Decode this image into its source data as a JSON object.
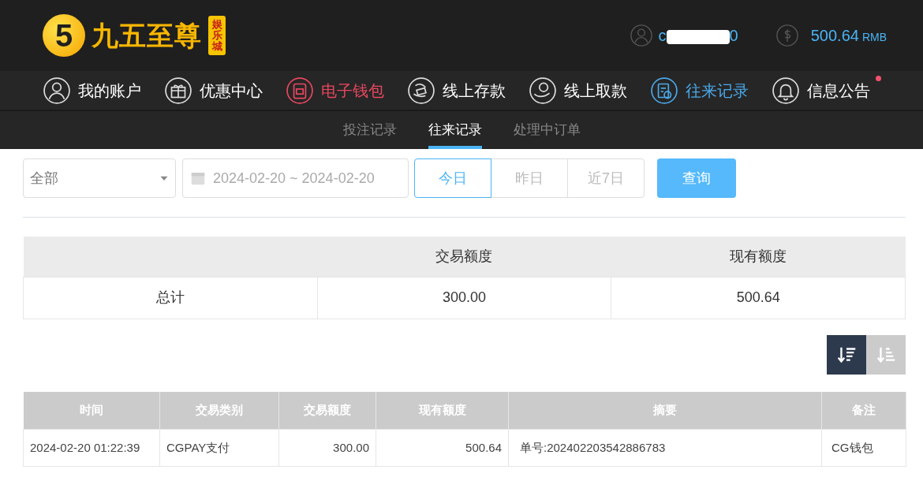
{
  "logo": {
    "mark": "5",
    "name": "九五至尊",
    "badge": "娱乐城"
  },
  "account": {
    "username_start": "c",
    "username_end": "0",
    "redacted": true,
    "balance": "500.64",
    "currency": "RMB"
  },
  "nav": [
    {
      "label": "我的账户",
      "kind": "user",
      "color": "#ffffff"
    },
    {
      "label": "优惠中心",
      "kind": "gift",
      "color": "#ffffff"
    },
    {
      "label": "电子钱包",
      "kind": "wallet",
      "color": "#e8475f"
    },
    {
      "label": "线上存款",
      "kind": "deposit",
      "color": "#ffffff"
    },
    {
      "label": "线上取款",
      "kind": "withdraw",
      "color": "#ffffff"
    },
    {
      "label": "往来记录",
      "kind": "record",
      "color": "#4aa8e8"
    },
    {
      "label": "信息公告",
      "kind": "bell",
      "color": "#ffffff",
      "dot": true
    }
  ],
  "subtabs": [
    {
      "label": "投注记录",
      "selected": false
    },
    {
      "label": "往来记录",
      "selected": true
    },
    {
      "label": "处理中订单",
      "selected": false
    }
  ],
  "filter": {
    "type_select": "全部",
    "date_range": "2024-02-20 ~ 2024-02-20",
    "quick": [
      {
        "label": "今日",
        "selected": true
      },
      {
        "label": "昨日",
        "selected": false
      },
      {
        "label": "近7日",
        "selected": false
      }
    ],
    "search_button": "查询"
  },
  "summary": {
    "columns": [
      "",
      "交易额度",
      "现有额度"
    ],
    "rows": [
      [
        "总计",
        "300.00",
        "500.64"
      ]
    ]
  },
  "sort_buttons": [
    {
      "kind": "desc",
      "selected": true
    },
    {
      "kind": "asc",
      "selected": false
    }
  ],
  "records": {
    "columns": [
      "时间",
      "交易类别",
      "交易额度",
      "现有额度",
      "摘要",
      "备注"
    ],
    "rows": [
      [
        "2024-02-20 01:22:39",
        "CGPAY支付",
        "300.00",
        "500.64",
        "单号:202402203542886783",
        "CG钱包"
      ]
    ]
  }
}
